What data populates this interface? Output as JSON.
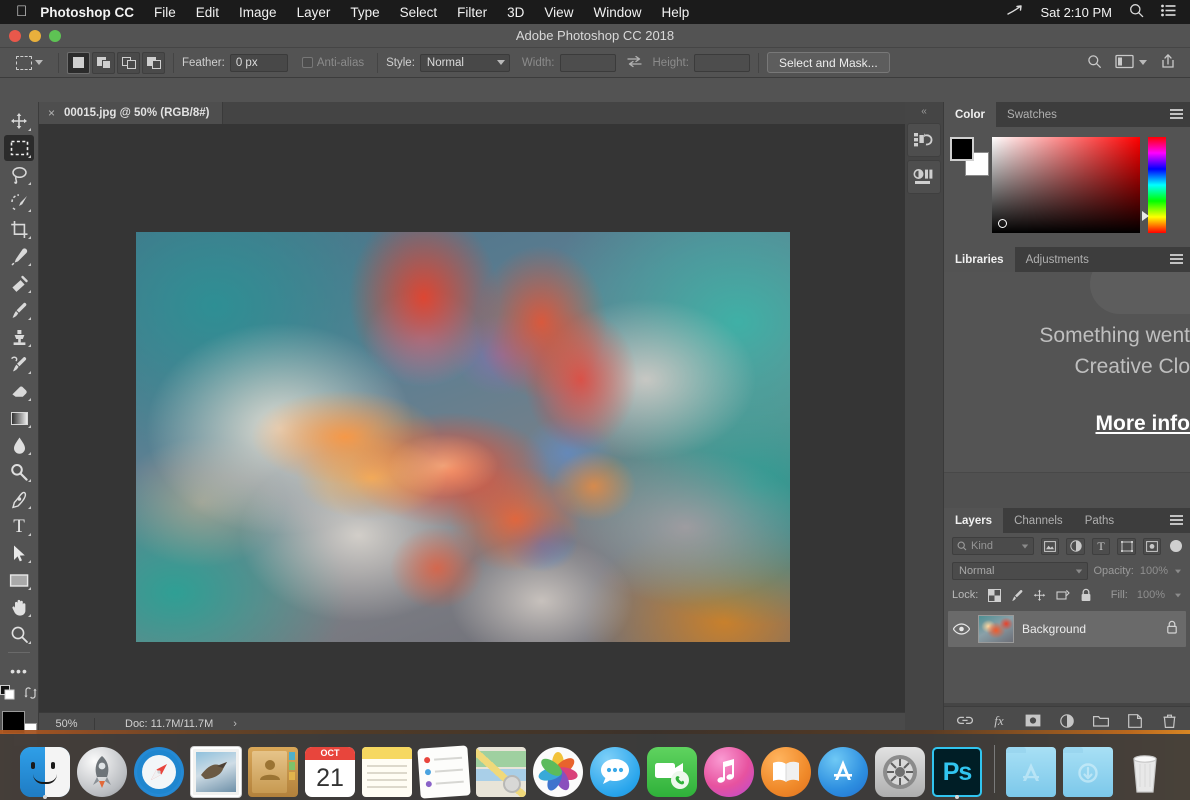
{
  "menubar": {
    "apple": "",
    "app_name": "Photoshop CC",
    "items": [
      "File",
      "Edit",
      "Image",
      "Layer",
      "Type",
      "Select",
      "Filter",
      "3D",
      "View",
      "Window",
      "Help"
    ],
    "clock": "Sat 2:10 PM",
    "icons": {
      "siri": "siri-icon",
      "search": "spotlight-search-icon",
      "controlcenter": "notification-center-icon"
    }
  },
  "window": {
    "title": "Adobe Photoshop CC 2018"
  },
  "options_bar": {
    "tool_name": "rectangular-marquee-tool",
    "selection_modes": [
      "new-selection",
      "add-to-selection",
      "subtract-from-selection",
      "intersect-with-selection"
    ],
    "feather_label": "Feather:",
    "feather_value": "0 px",
    "antialias_label": "Anti-alias",
    "style_label": "Style:",
    "style_value": "Normal",
    "width_label": "Width:",
    "width_value": "",
    "height_label": "Height:",
    "height_value": "",
    "select_and_mask": "Select and Mask...",
    "right_icons": [
      "search-icon",
      "arrange-documents-icon",
      "share-icon"
    ]
  },
  "document": {
    "tab_label": "00015.jpg @ 50% (RGB/8#)",
    "close": "×",
    "zoom": "50%",
    "doc_size": "Doc: 11.7M/11.7M",
    "status_arrow": "›"
  },
  "toolbar": {
    "tools": [
      {
        "name": "move-tool",
        "selected": false
      },
      {
        "name": "rectangular-marquee-tool",
        "selected": true
      },
      {
        "name": "lasso-tool",
        "selected": false
      },
      {
        "name": "quick-selection-tool",
        "selected": false
      },
      {
        "name": "crop-tool",
        "selected": false
      },
      {
        "name": "eyedropper-tool",
        "selected": false
      },
      {
        "name": "spot-healing-brush-tool",
        "selected": false
      },
      {
        "name": "brush-tool",
        "selected": false
      },
      {
        "name": "clone-stamp-tool",
        "selected": false
      },
      {
        "name": "history-brush-tool",
        "selected": false
      },
      {
        "name": "eraser-tool",
        "selected": false
      },
      {
        "name": "gradient-tool",
        "selected": false
      },
      {
        "name": "blur-tool",
        "selected": false
      },
      {
        "name": "dodge-tool",
        "selected": false
      },
      {
        "name": "pen-tool",
        "selected": false
      },
      {
        "name": "horizontal-type-tool",
        "selected": false
      },
      {
        "name": "path-selection-tool",
        "selected": false
      },
      {
        "name": "rectangle-tool",
        "selected": false
      },
      {
        "name": "hand-tool",
        "selected": false
      },
      {
        "name": "zoom-tool",
        "selected": false
      },
      {
        "name": "edit-toolbar-tool",
        "selected": false
      }
    ],
    "type_glyph": "T",
    "edit_glyph": "•••",
    "foreground_color": "#000000",
    "background_color": "#ffffff"
  },
  "mini_dock": {
    "collapse_glyph": "«",
    "buttons": [
      "history-panel-icon",
      "properties-panel-icon"
    ]
  },
  "panels": {
    "color": {
      "tabs": [
        {
          "label": "Color",
          "active": true
        },
        {
          "label": "Swatches",
          "active": false
        }
      ],
      "foreground_color": "#000000",
      "background_color": "#ffffff",
      "hue_base": "#ff0000"
    },
    "libraries": {
      "tabs": [
        {
          "label": "Libraries",
          "active": true
        },
        {
          "label": "Adjustments",
          "active": false
        }
      ],
      "message_line1": "Something went",
      "message_line2": "Creative Clo",
      "more_info": "More info"
    },
    "layers": {
      "tabs": [
        {
          "label": "Layers",
          "active": true
        },
        {
          "label": "Channels",
          "active": false
        },
        {
          "label": "Paths",
          "active": false
        }
      ],
      "kind_label": "Kind",
      "filter_icons": [
        "filter-pixel-icon",
        "filter-adjustment-icon",
        "filter-type-icon",
        "filter-shape-icon",
        "filter-smart-object-icon"
      ],
      "blend_mode": "Normal",
      "opacity_label": "Opacity:",
      "opacity_value": "100%",
      "lock_label": "Lock:",
      "lock_icons": [
        "lock-transparent-pixels-icon",
        "lock-image-pixels-icon",
        "lock-position-icon",
        "lock-artboard-icon",
        "lock-all-icon"
      ],
      "fill_label": "Fill:",
      "fill_value": "100%",
      "rows": [
        {
          "name": "Background",
          "visible": true,
          "locked": true
        }
      ],
      "footer_icons": [
        "link-layers-icon",
        "layer-style-fx-icon",
        "add-layer-mask-icon",
        "new-adjustment-layer-icon",
        "new-group-icon",
        "new-layer-icon",
        "delete-layer-icon"
      ],
      "fx_glyph": "fx"
    }
  },
  "dock": {
    "items": [
      {
        "name": "finder",
        "running": true
      },
      {
        "name": "launchpad",
        "running": false
      },
      {
        "name": "safari",
        "running": false
      },
      {
        "name": "mail",
        "running": false
      },
      {
        "name": "contacts",
        "running": false
      },
      {
        "name": "calendar",
        "running": false,
        "month": "OCT",
        "day": "21"
      },
      {
        "name": "notes",
        "running": false
      },
      {
        "name": "reminders",
        "running": false
      },
      {
        "name": "maps",
        "running": false
      },
      {
        "name": "photos",
        "running": false
      },
      {
        "name": "messages",
        "running": false
      },
      {
        "name": "facetime",
        "running": false
      },
      {
        "name": "itunes",
        "running": false
      },
      {
        "name": "ibooks",
        "running": false
      },
      {
        "name": "app-store",
        "running": false
      },
      {
        "name": "system-preferences",
        "running": false
      },
      {
        "name": "photoshop",
        "running": true,
        "label": "Ps"
      }
    ],
    "right_items": [
      {
        "name": "applications-folder"
      },
      {
        "name": "downloads-folder"
      },
      {
        "name": "trash"
      }
    ]
  },
  "artwork": {
    "description": "colorful paint explosion",
    "palette": [
      "#1f6f78",
      "#2fa39a",
      "#e8412a",
      "#ff7a2a",
      "#ffc061",
      "#e9e2d6",
      "#6f86b5",
      "#8a5ba8",
      "#c0762a"
    ]
  }
}
